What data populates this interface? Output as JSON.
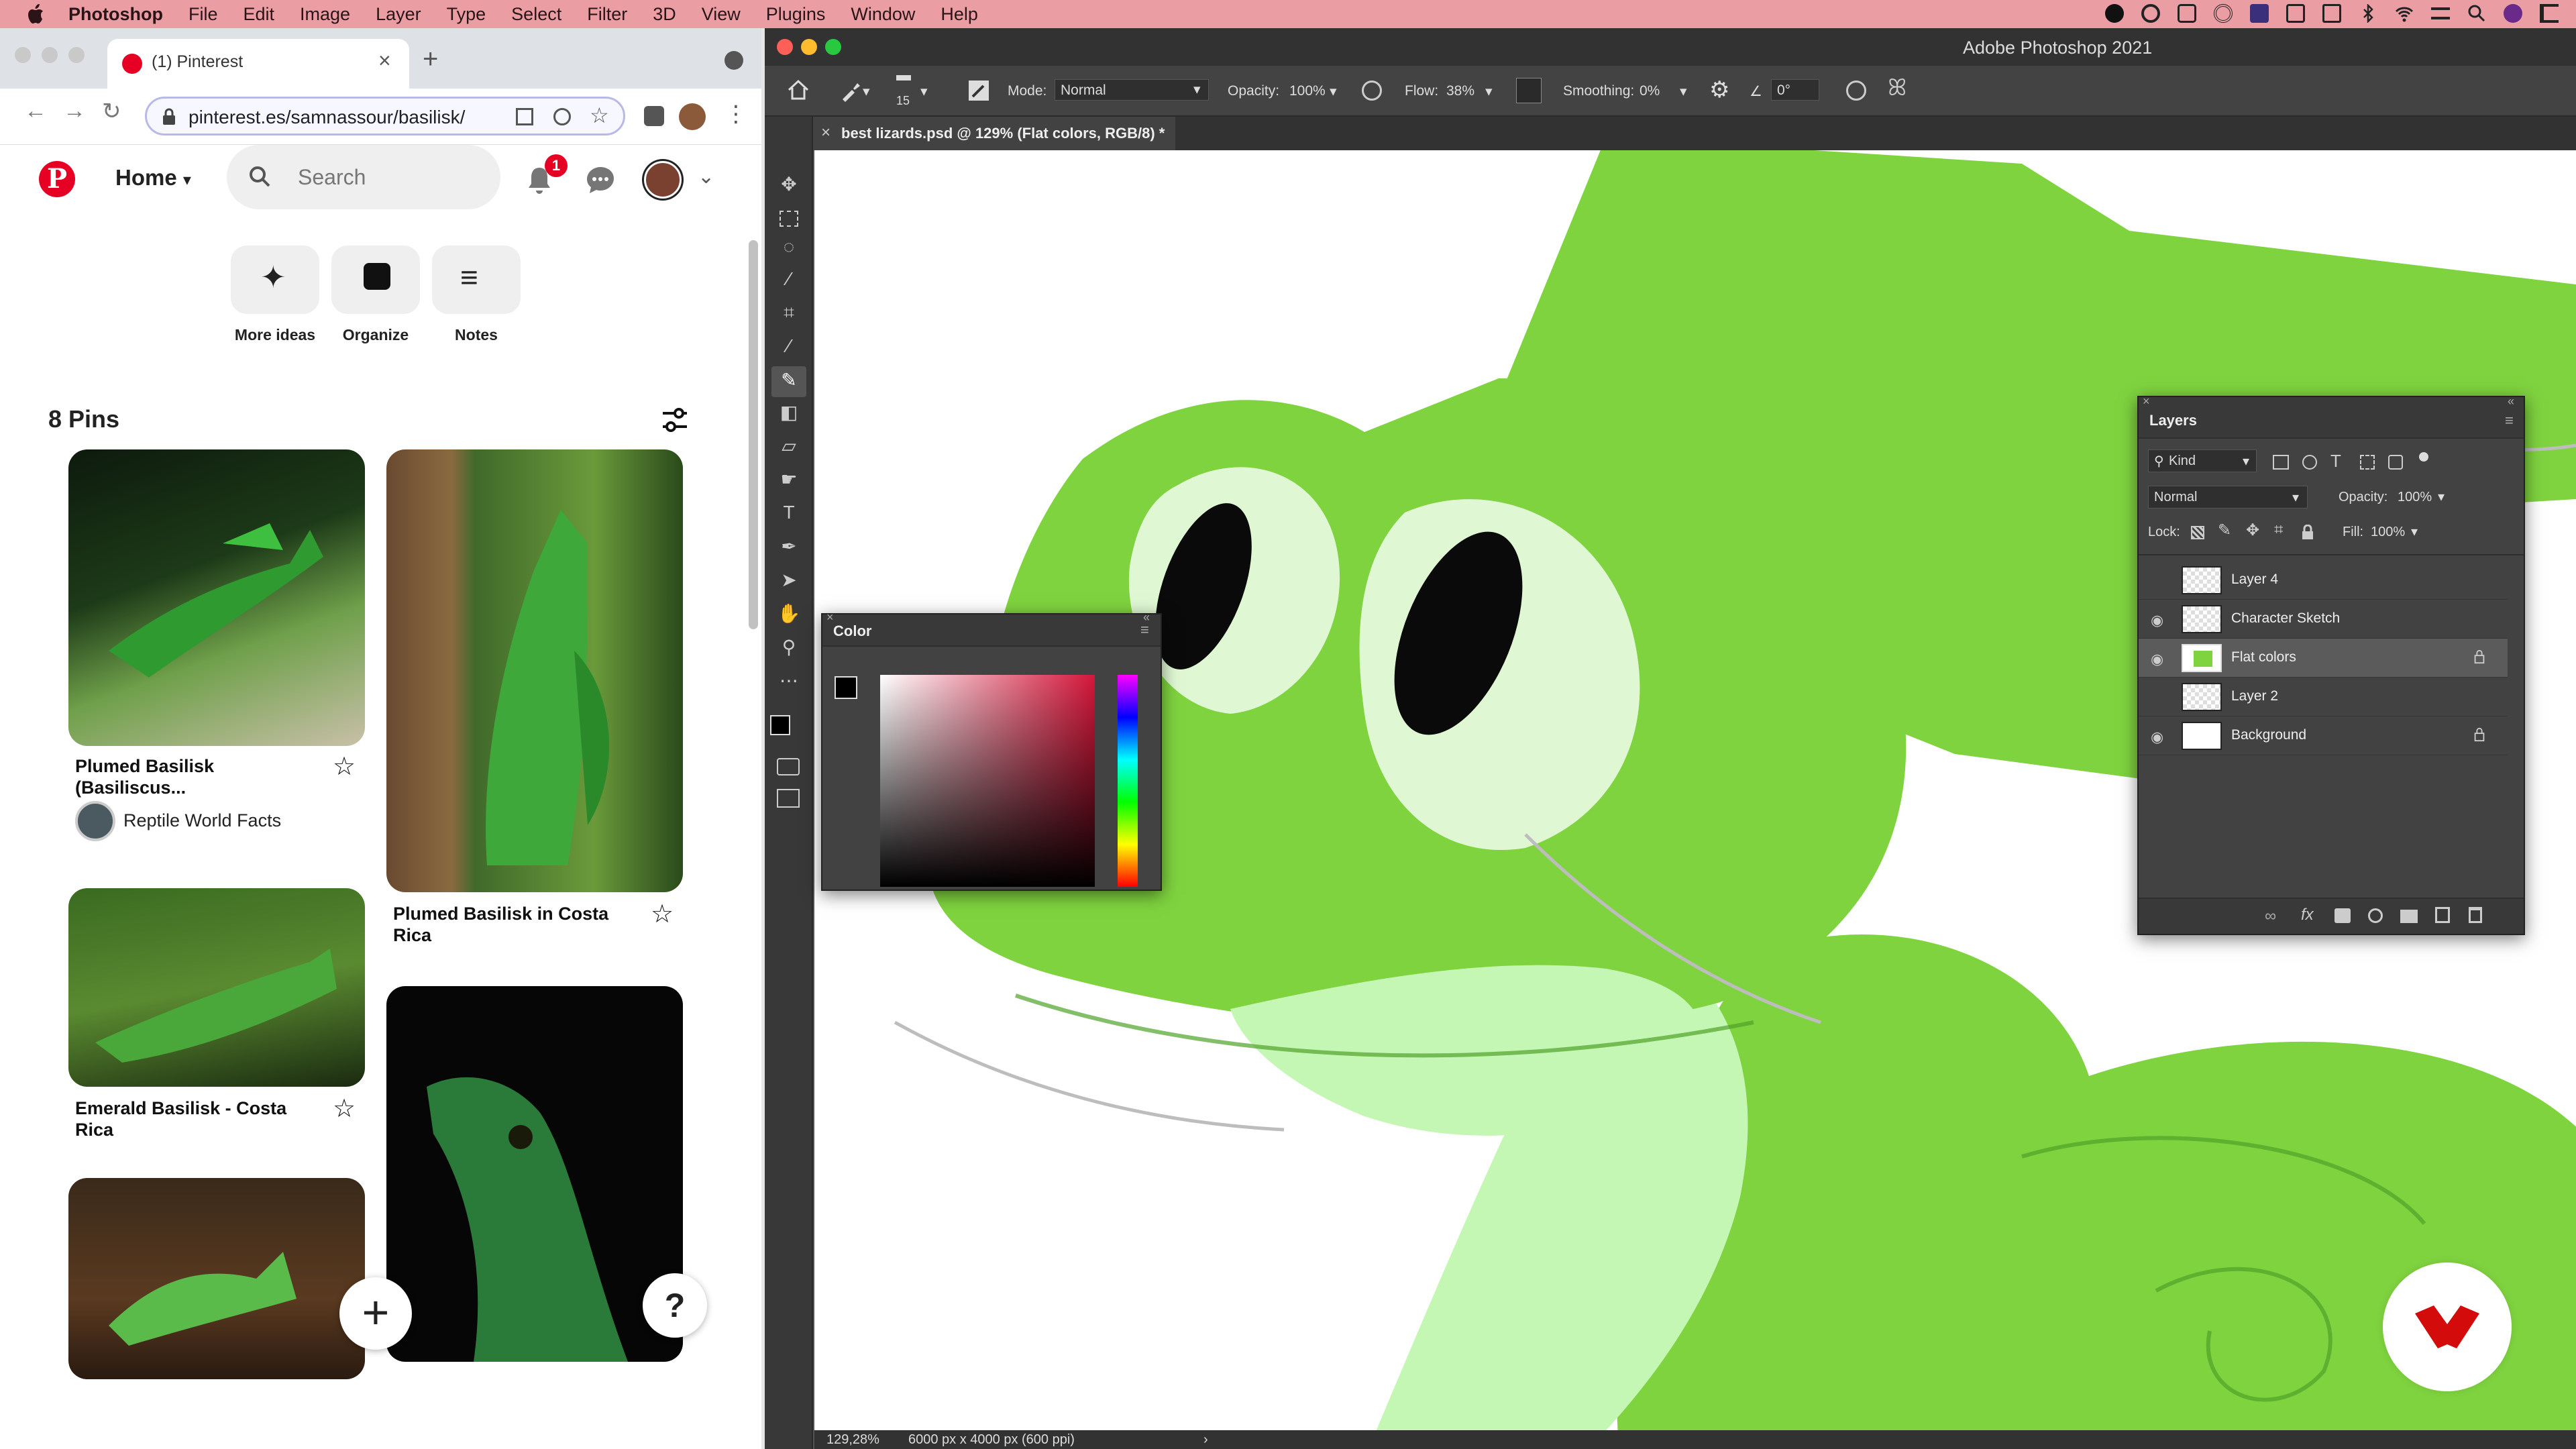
{
  "menubar": {
    "app": "Photoshop",
    "items": [
      "File",
      "Edit",
      "Image",
      "Layer",
      "Type",
      "Select",
      "Filter",
      "3D",
      "View",
      "Plugins",
      "Window",
      "Help"
    ]
  },
  "browser": {
    "tab_title": "(1) Pinterest",
    "url": "pinterest.es/samnassour/basilisk/",
    "notification_count": "1"
  },
  "pinterest": {
    "nav_home": "Home",
    "search_placeholder": "Search",
    "quick_actions": [
      "More ideas",
      "Organize",
      "Notes"
    ],
    "pins_count": "8 Pins",
    "pins": [
      {
        "title": "Plumed Basilisk (Basiliscus...",
        "creator": "Reptile World Facts"
      },
      {
        "title": "Plumed Basilisk in Costa Rica"
      },
      {
        "title": "Emerald Basilisk - Costa Rica"
      }
    ],
    "help_label": "?"
  },
  "photoshop": {
    "window_title": "Adobe Photoshop 2021",
    "options": {
      "brush_size": "15",
      "mode_label": "Mode:",
      "mode_value": "Normal",
      "opacity_label": "Opacity:",
      "opacity_value": "100%",
      "flow_label": "Flow:",
      "flow_value": "38%",
      "smoothing_label": "Smoothing:",
      "smoothing_value": "0%",
      "angle_value": "0°"
    },
    "document_tab": "best lizards.psd @ 129% (Flat colors, RGB/8) *",
    "status": {
      "zoom": "129,28%",
      "doc_size": "6000 px x 4000 px (600 ppi)"
    },
    "color_panel": {
      "title": "Color"
    },
    "layers_panel": {
      "title": "Layers",
      "filter_label": "Kind",
      "blend_mode": "Normal",
      "opacity_label": "Opacity:",
      "opacity_value": "100%",
      "lock_label": "Lock:",
      "fill_label": "Fill:",
      "fill_value": "100%",
      "layers": [
        {
          "name": "Layer 4",
          "visible": false,
          "locked": false
        },
        {
          "name": "Character Sketch",
          "visible": true,
          "locked": false
        },
        {
          "name": "Flat colors",
          "visible": true,
          "locked": true,
          "selected": true
        },
        {
          "name": "Layer 2",
          "visible": false,
          "locked": false
        },
        {
          "name": "Background",
          "visible": true,
          "locked": true
        }
      ]
    },
    "colors": {
      "canvas_green": "#7fd33f",
      "canvas_light_green": "#c5f7b4",
      "brand_red": "#e60023"
    }
  }
}
